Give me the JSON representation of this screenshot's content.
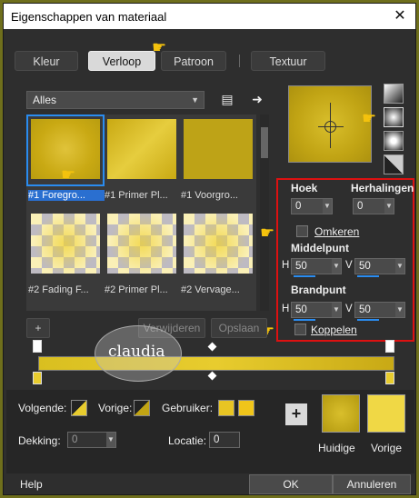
{
  "window": {
    "title": "Eigenschappen van materiaal",
    "close": "✕"
  },
  "tabs": [
    {
      "label": "Kleur"
    },
    {
      "label": "Verloop"
    },
    {
      "label": "Patroon"
    },
    {
      "label": "Textuur"
    }
  ],
  "filter": {
    "selected": "Alles"
  },
  "gallery": [
    {
      "caption": "#1 Foregro..."
    },
    {
      "caption": "#1 Primer Pl..."
    },
    {
      "caption": "#1 Voorgro..."
    },
    {
      "caption": "#2 Fading F..."
    },
    {
      "caption": "#2 Primer Pl..."
    },
    {
      "caption": "#2 Vervage..."
    }
  ],
  "params": {
    "hoek_label": "Hoek",
    "hoek_value": "0",
    "herhalingen_label": "Herhalingen",
    "herhalingen_value": "0",
    "omkeren_label": "Omkeren",
    "middelpunt_label": "Middelpunt",
    "h_label": "H",
    "v_label": "V",
    "middel_h": "50",
    "middel_v": "50",
    "brandpunt_label": "Brandpunt",
    "brand_h": "50",
    "brand_v": "50",
    "koppelen_label": "Koppelen"
  },
  "gradient_buttons": {
    "plus": "+",
    "verwijderen": "Verwijderen",
    "opslaan": "Opslaan"
  },
  "watermark": "claudia",
  "bottom": {
    "volgende_label": "Volgende:",
    "vorige_label": "Vorige:",
    "gebruiker_label": "Gebruiker:",
    "dekking_label": "Dekking:",
    "dekking_value": "0",
    "locatie_label": "Locatie:",
    "locatie_value": "0",
    "huidige_label": "Huidige",
    "vorige_swatch_label": "Vorige",
    "plus": "+"
  },
  "footer": {
    "help": "Help",
    "ok": "OK",
    "cancel": "Annuleren"
  },
  "colors": {
    "accent": "#2a8cf0",
    "current": "#c1a414",
    "previous": "#f0d845",
    "highlight": "#dd1111"
  }
}
